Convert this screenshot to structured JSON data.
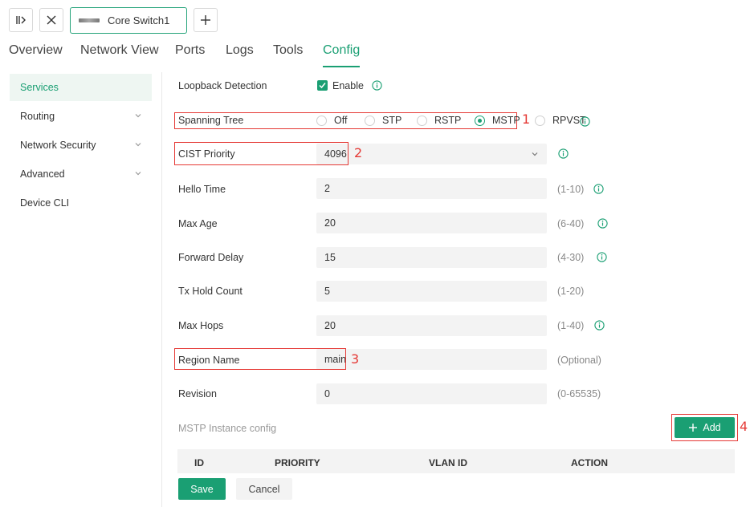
{
  "device_tab": {
    "label": "Core Switch1"
  },
  "nav_tabs": [
    {
      "label": "Overview"
    },
    {
      "label": "Network View"
    },
    {
      "label": "Ports"
    },
    {
      "label": "Logs"
    },
    {
      "label": "Tools"
    },
    {
      "label": "Config"
    }
  ],
  "sidebar": {
    "items": [
      {
        "label": "Services"
      },
      {
        "label": "Routing"
      },
      {
        "label": "Network Security"
      },
      {
        "label": "Advanced"
      },
      {
        "label": "Device CLI"
      }
    ]
  },
  "form": {
    "loopback": {
      "label": "Loopback Detection",
      "option": "Enable"
    },
    "spanning_tree": {
      "label": "Spanning Tree",
      "options": [
        "Off",
        "STP",
        "RSTP",
        "MSTP",
        "RPVST"
      ],
      "selected": "MSTP"
    },
    "cist_priority": {
      "label": "CIST Priority",
      "value": "4096"
    },
    "hello_time": {
      "label": "Hello Time",
      "value": "2",
      "range": "(1-10)"
    },
    "max_age": {
      "label": "Max Age",
      "value": "20",
      "range": "(6-40)"
    },
    "forward_delay": {
      "label": "Forward Delay",
      "value": "15",
      "range": "(4-30)"
    },
    "tx_hold_count": {
      "label": "Tx Hold Count",
      "value": "5",
      "range": "(1-20)"
    },
    "max_hops": {
      "label": "Max Hops",
      "value": "20",
      "range": "(1-40)"
    },
    "region_name": {
      "label": "Region Name",
      "value": "main",
      "range": "(Optional)"
    },
    "revision": {
      "label": "Revision",
      "value": "0",
      "range": "(0-65535)"
    }
  },
  "mstp_instance": {
    "title": "MSTP Instance config",
    "add_label": "Add",
    "columns": [
      "ID",
      "PRIORITY",
      "VLAN ID",
      "ACTION"
    ]
  },
  "buttons": {
    "save": "Save",
    "cancel": "Cancel"
  },
  "annotations": [
    "1",
    "2",
    "3",
    "4"
  ],
  "colors": {
    "accent": "#1a9f73",
    "annotation": "#e53935"
  }
}
